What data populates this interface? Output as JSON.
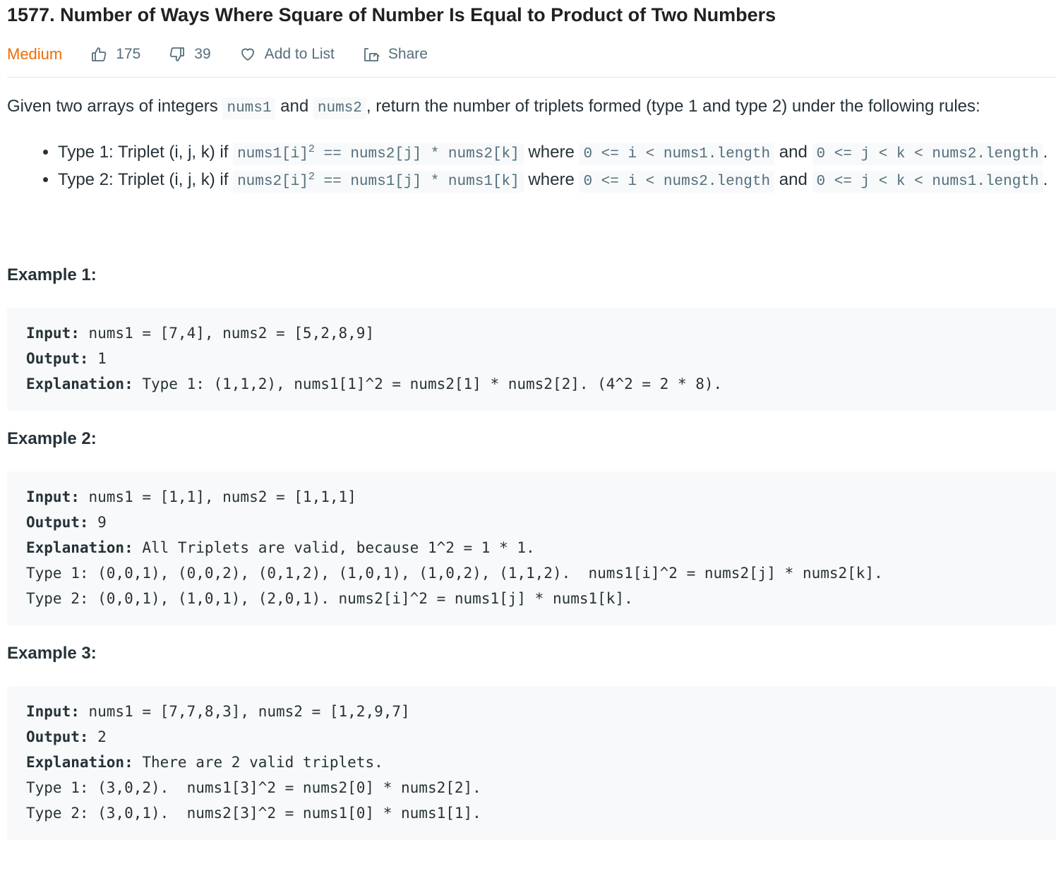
{
  "problem": {
    "title": "1577. Number of Ways Where Square of Number Is Equal to Product of Two Numbers",
    "difficulty": "Medium",
    "likes": "175",
    "dislikes": "39",
    "add_to_list_label": "Add to List",
    "share_label": "Share"
  },
  "description": {
    "p1_a": "Given two arrays of integers ",
    "p1_code1": "nums1",
    "p1_b": " and ",
    "p1_code2": "nums2",
    "p1_c": ", return the number of triplets formed (type 1 and type 2) under the following rules:",
    "rules": [
      {
        "prefix": "Type 1: Triplet (i, j, k) if ",
        "code1_a": "nums1[i]",
        "code1_sup": "2",
        "code1_b": " == nums2[j] * nums2[k]",
        "where": " where ",
        "code2": "0 <= i < nums1.length",
        "and": " and ",
        "code3": "0 <= j < k < nums2.length",
        "suffix": "."
      },
      {
        "prefix": "Type 2: Triplet (i, j, k) if ",
        "code1_a": "nums2[i]",
        "code1_sup": "2",
        "code1_b": " == nums1[j] * nums1[k]",
        "where": " where ",
        "code2": "0 <= i < nums2.length",
        "and": " and ",
        "code3": "0 <= j < k < nums1.length",
        "suffix": "."
      }
    ]
  },
  "examples": [
    {
      "heading": "Example 1:",
      "input_label": "Input:",
      "input": " nums1 = [7,4], nums2 = [5,2,8,9]",
      "output_label": "Output:",
      "output": " 1",
      "explanation_label": "Explanation:",
      "explanation": " Type 1: (1,1,2), nums1[1]^2 = nums2[1] * nums2[2]. (4^2 = 2 * 8).",
      "extra_lines": []
    },
    {
      "heading": "Example 2:",
      "input_label": "Input:",
      "input": " nums1 = [1,1], nums2 = [1,1,1]",
      "output_label": "Output:",
      "output": " 9",
      "explanation_label": "Explanation:",
      "explanation": " All Triplets are valid, because 1^2 = 1 * 1.",
      "extra_lines": [
        "Type 1: (0,0,1), (0,0,2), (0,1,2), (1,0,1), (1,0,2), (1,1,2).  nums1[i]^2 = nums2[j] * nums2[k].",
        "Type 2: (0,0,1), (1,0,1), (2,0,1). nums2[i]^2 = nums1[j] * nums1[k]."
      ]
    },
    {
      "heading": "Example 3:",
      "input_label": "Input:",
      "input": " nums1 = [7,7,8,3], nums2 = [1,2,9,7]",
      "output_label": "Output:",
      "output": " 2",
      "explanation_label": "Explanation:",
      "explanation": " There are 2 valid triplets.",
      "extra_lines": [
        "Type 1: (3,0,2).  nums1[3]^2 = nums2[0] * nums2[2].",
        "Type 2: (3,0,1).  nums2[3]^2 = nums1[0] * nums1[1]."
      ]
    }
  ],
  "colors": {
    "difficulty_medium": "#ef6c00",
    "meta_text": "#546e7a",
    "code_bg": "#f7f9fa"
  }
}
